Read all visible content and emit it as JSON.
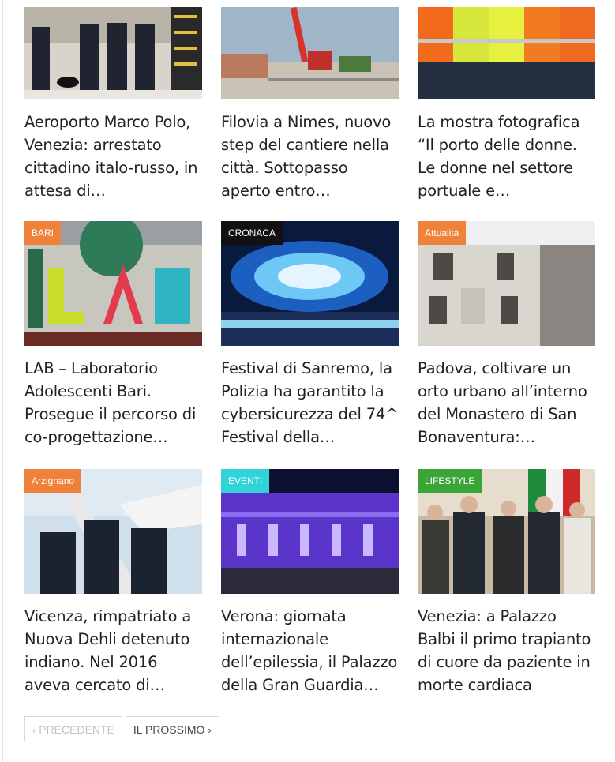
{
  "articles": [
    {
      "title": "Aeroporto Marco Polo, Venezia: arrestato cittadino italo-russo, in attesa di…",
      "category": "",
      "badge_color": ""
    },
    {
      "title": "Filovia a Nimes, nuovo step del cantiere nella città. Sottopasso aperto entro…",
      "category": "",
      "badge_color": ""
    },
    {
      "title": "La mostra fotografica “Il porto delle donne. Le donne nel settore portuale e…",
      "category": "",
      "badge_color": ""
    },
    {
      "title": "LAB – Laboratorio Adolescenti Bari. Prosegue il percorso di co-progettazione…",
      "category": "BARI",
      "badge_color": "#f0813a"
    },
    {
      "title": "Festival di Sanremo, la Polizia ha garantito la cybersicurezza del 74^ Festival della…",
      "category": "CRONACA",
      "badge_color": "#111111"
    },
    {
      "title": "Padova, coltivare un orto urbano all’interno del Monastero di San Bonaventura:…",
      "category": "Attualità",
      "badge_color": "#f0813a"
    },
    {
      "title": "Vicenza, rimpatriato a Nuova Dehli detenuto indiano. Nel 2016 aveva cercato di…",
      "category": "Arzignano",
      "badge_color": "#f0813a"
    },
    {
      "title": "Verona: giornata internazionale dell’epilessia, il Palazzo della Gran Guardia…",
      "category": "EVENTI",
      "badge_color": "#2fd3d8"
    },
    {
      "title": "Venezia: a Palazzo Balbi il primo trapianto di cuore da paziente in morte cardiaca",
      "category": "LIFESTYLE",
      "badge_color": "#3aa437"
    }
  ],
  "pagination": {
    "prev_label": "PRECEDENTE",
    "next_label": "IL PROSSIMO",
    "prev_icon": "chevron-left-icon",
    "next_icon": "chevron-right-icon"
  }
}
